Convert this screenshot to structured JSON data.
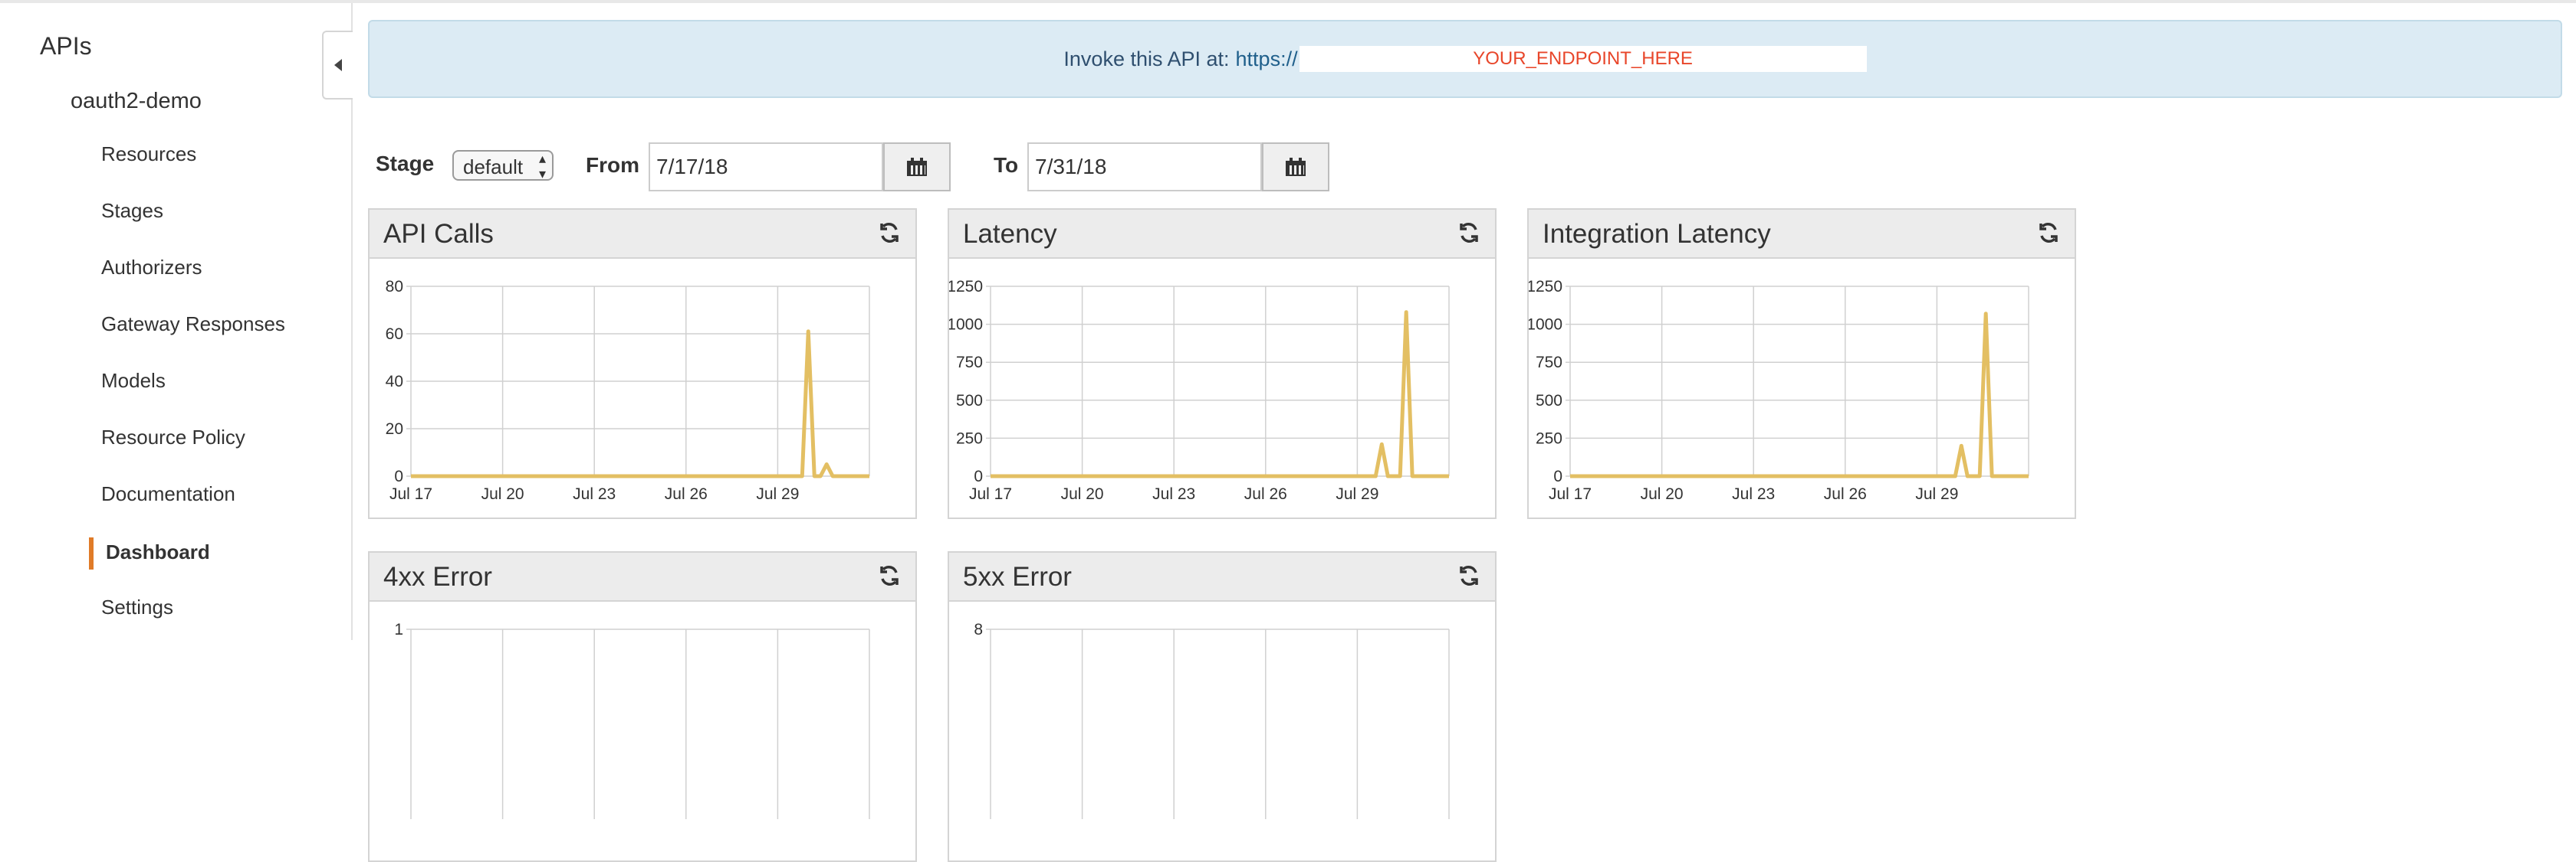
{
  "sidebar": {
    "root": "APIs",
    "api_name": "oauth2-demo",
    "items": [
      {
        "label": "Resources",
        "active": false
      },
      {
        "label": "Stages",
        "active": false
      },
      {
        "label": "Authorizers",
        "active": false
      },
      {
        "label": "Gateway Responses",
        "active": false
      },
      {
        "label": "Models",
        "active": false
      },
      {
        "label": "Resource Policy",
        "active": false
      },
      {
        "label": "Documentation",
        "active": false
      },
      {
        "label": "Dashboard",
        "active": true
      },
      {
        "label": "Settings",
        "active": false
      }
    ],
    "accent_color": "#e07b28",
    "collapse_icon": "chevron-left-icon"
  },
  "banner": {
    "text": "Invoke this API at:",
    "url_prefix": "https://",
    "endpoint_placeholder": "YOUR_ENDPOINT_HERE"
  },
  "filters": {
    "stage_label": "Stage",
    "stage_value": "default",
    "from_label": "From",
    "from_value": "7/17/18",
    "to_label": "To",
    "to_value": "7/31/18",
    "calendar_icon": "calendar-icon"
  },
  "panels": [
    {
      "title": "API Calls",
      "refresh_icon": "refresh-icon"
    },
    {
      "title": "Latency",
      "refresh_icon": "refresh-icon"
    },
    {
      "title": "Integration Latency",
      "refresh_icon": "refresh-icon"
    },
    {
      "title": "4xx Error",
      "refresh_icon": "refresh-icon"
    },
    {
      "title": "5xx Error",
      "refresh_icon": "refresh-icon"
    }
  ],
  "chart_data": [
    {
      "type": "line",
      "title": "API Calls",
      "x_ticks": [
        "Jul 17",
        "Jul 20",
        "Jul 23",
        "Jul 26",
        "Jul 29"
      ],
      "y_ticks": [
        0,
        20,
        40,
        60,
        80
      ],
      "ylim": [
        0,
        80
      ],
      "xlim": [
        0,
        15
      ],
      "grid": true,
      "color": "#e3bf63",
      "series": [
        {
          "x": [
            0,
            12.8,
            13.0,
            13.2,
            13.4,
            13.6,
            13.8,
            14.0,
            15
          ],
          "y": [
            0,
            0,
            61,
            0,
            0,
            5,
            0,
            0,
            0
          ]
        }
      ]
    },
    {
      "type": "line",
      "title": "Latency",
      "x_ticks": [
        "Jul 17",
        "Jul 20",
        "Jul 23",
        "Jul 26",
        "Jul 29"
      ],
      "y_ticks": [
        0,
        250,
        500,
        750,
        1000,
        1250
      ],
      "ylim": [
        0,
        1250
      ],
      "xlim": [
        0,
        15
      ],
      "grid": true,
      "color": "#e3bf63",
      "series": [
        {
          "x": [
            0,
            12.6,
            12.8,
            13.0,
            13.4,
            13.6,
            13.8,
            14.0,
            15
          ],
          "y": [
            0,
            0,
            210,
            0,
            0,
            1080,
            0,
            0,
            0
          ]
        }
      ]
    },
    {
      "type": "line",
      "title": "Integration Latency",
      "x_ticks": [
        "Jul 17",
        "Jul 20",
        "Jul 23",
        "Jul 26",
        "Jul 29"
      ],
      "y_ticks": [
        0,
        250,
        500,
        750,
        1000,
        1250
      ],
      "ylim": [
        0,
        1250
      ],
      "xlim": [
        0,
        15
      ],
      "grid": true,
      "color": "#e3bf63",
      "series": [
        {
          "x": [
            0,
            12.6,
            12.8,
            13.0,
            13.4,
            13.6,
            13.8,
            14.0,
            15
          ],
          "y": [
            0,
            0,
            200,
            0,
            0,
            1070,
            0,
            0,
            0
          ]
        }
      ]
    },
    {
      "type": "line",
      "title": "4xx Error",
      "x_ticks": [],
      "y_ticks": [
        1
      ],
      "ylim": [
        0,
        1
      ],
      "xlim": [
        0,
        15
      ],
      "grid": true,
      "color": "#e3bf63",
      "series": []
    },
    {
      "type": "line",
      "title": "5xx Error",
      "x_ticks": [],
      "y_ticks": [
        8
      ],
      "ylim": [
        0,
        8
      ],
      "xlim": [
        0,
        15
      ],
      "grid": true,
      "color": "#e3bf63",
      "series": []
    }
  ]
}
